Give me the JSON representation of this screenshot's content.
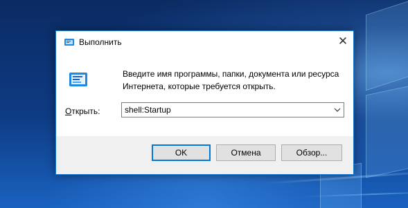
{
  "window": {
    "title": "Выполнить",
    "close_symbol": "✕"
  },
  "description": {
    "line1": "Введите имя программы, папки, документа или ресурса",
    "line2": "Интернета, которые требуется открыть."
  },
  "open": {
    "label_mnemonic": "О",
    "label_rest": "ткрыть:",
    "value": "shell:Startup"
  },
  "buttons": {
    "ok": "OK",
    "cancel": "Отмена",
    "browse": "Обзор..."
  },
  "icons": {
    "title": "run-icon",
    "big": "run-icon",
    "dropdown": "chevron-down-icon",
    "close": "close-icon"
  },
  "colors": {
    "accent": "#0078d7",
    "border": "#1979ca"
  }
}
